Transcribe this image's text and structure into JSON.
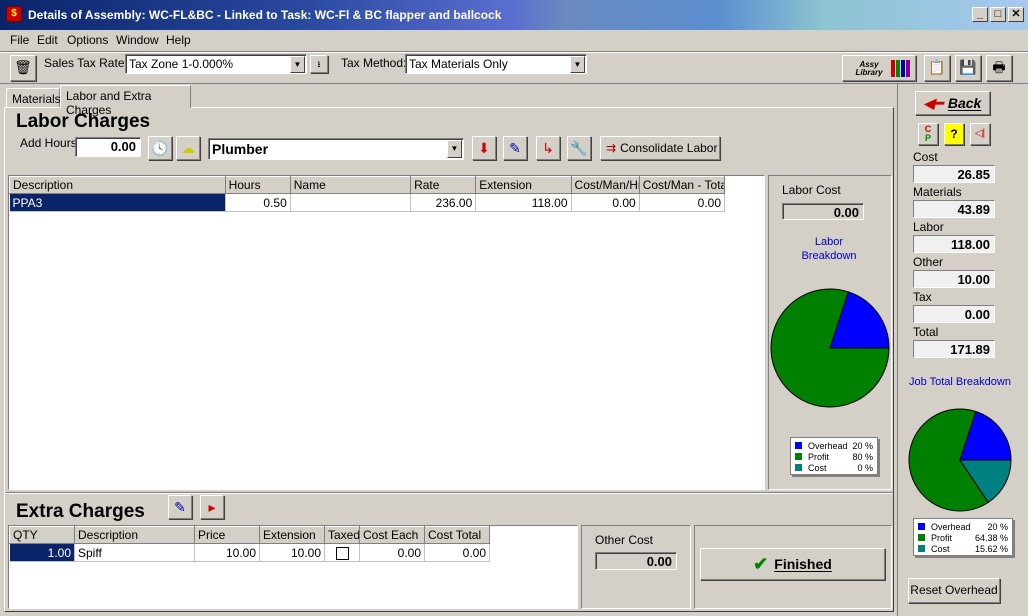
{
  "window": {
    "title": "Details of Assembly: WC-FL&BC - Linked to Task: WC-Fl & BC flapper and ballcock",
    "controls": [
      "_",
      "□",
      "✕"
    ]
  },
  "menu": [
    "File",
    "Edit",
    "Options",
    "Window",
    "Help"
  ],
  "toolbar": {
    "sales_tax_label": "Sales Tax Rate:",
    "sales_tax_value": "Tax Zone 1-0.000%",
    "tax_method_label": "Tax Method:",
    "tax_method_value": "Tax Materials Only",
    "assy_library_label": "Assy Library"
  },
  "tabs": [
    "Materials",
    "Labor and Extra Charges"
  ],
  "labor": {
    "heading": "Labor Charges",
    "add_hours_label": "Add Hours",
    "add_hours_value": "0.00",
    "trade_value": "Plumber",
    "consolidate_label": "Consolidate Labor",
    "columns": [
      "Description",
      "Hours",
      "Name",
      "Rate",
      "Extension",
      "Cost/Man/Hr",
      "Cost/Man - Total"
    ],
    "rows": [
      [
        "PPA3",
        "0.50",
        "",
        "236.00",
        "118.00",
        "0.00",
        "0.00"
      ]
    ],
    "cost_label": "Labor Cost",
    "cost_value": "0.00",
    "breakdown_title": "Labor Breakdown",
    "legend": [
      {
        "name": "Overhead",
        "value": "20 %",
        "color": "#0000ff"
      },
      {
        "name": "Profit",
        "value": "80 %",
        "color": "#008000"
      },
      {
        "name": "Cost",
        "value": "0 %",
        "color": "#008080"
      }
    ],
    "pie_fractions": [
      0.2,
      0.8,
      0.0
    ]
  },
  "extra": {
    "heading": "Extra Charges",
    "columns": [
      "QTY",
      "Description",
      "Price",
      "Extension",
      "Taxed",
      "Cost Each",
      "Cost Total"
    ],
    "rows": [
      [
        "1.00",
        "Spiff",
        "10.00",
        "10.00",
        "",
        "0.00",
        "0.00"
      ]
    ],
    "other_cost_label": "Other Cost",
    "other_cost_value": "0.00",
    "finished_label": "Finished"
  },
  "side": {
    "back_label": "Back",
    "items": [
      {
        "label": "Cost",
        "value": "26.85"
      },
      {
        "label": "Materials",
        "value": "43.89"
      },
      {
        "label": "Labor",
        "value": "118.00"
      },
      {
        "label": "Other",
        "value": "10.00"
      },
      {
        "label": "Tax",
        "value": "0.00"
      },
      {
        "label": "Total",
        "value": "171.89"
      }
    ],
    "breakdown_title": "Job Total Breakdown",
    "legend": [
      {
        "name": "Overhead",
        "value": "20 %",
        "color": "#0000ff"
      },
      {
        "name": "Profit",
        "value": "64.38 %",
        "color": "#008000"
      },
      {
        "name": "Cost",
        "value": "15.62 %",
        "color": "#008080"
      }
    ],
    "pie_fractions": [
      0.2,
      0.6438,
      0.1562
    ],
    "reset_label": "Reset Overhead"
  }
}
